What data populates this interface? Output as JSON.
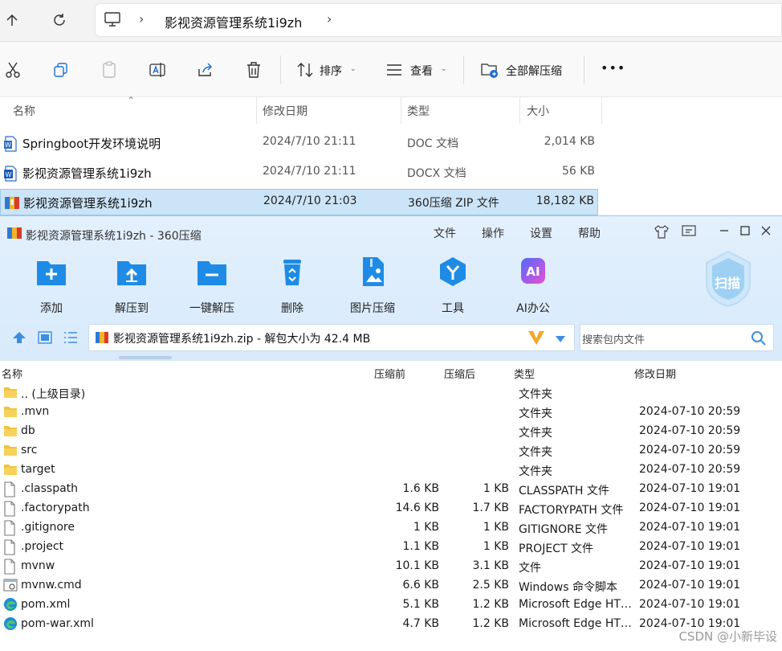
{
  "explorer": {
    "breadcrumb": "影视资源管理系统1i9zh",
    "toolbar": {
      "sort_label": "排序",
      "view_label": "查看",
      "extract_all_label": "全部解压缩",
      "more_label": "•••"
    },
    "columns": {
      "name": "名称",
      "date": "修改日期",
      "type": "类型",
      "size": "大小"
    },
    "files": [
      {
        "name": "Springboot开发环境说明",
        "date": "2024/7/10 21:11",
        "type": "DOC 文档",
        "size": "2,014 KB"
      },
      {
        "name": "影视资源管理系统1i9zh",
        "date": "2024/7/10 21:11",
        "type": "DOCX 文档",
        "size": "56 KB"
      },
      {
        "name": "影视资源管理系统1i9zh",
        "date": "2024/7/10 21:03",
        "type": "360压缩 ZIP 文件",
        "size": "18,182 KB"
      }
    ]
  },
  "zip": {
    "title": "影视资源管理系统1i9zh - 360压缩",
    "menu": [
      "文件",
      "操作",
      "设置",
      "帮助"
    ],
    "buttons": [
      "添加",
      "解压到",
      "一键解压",
      "删除",
      "图片压缩",
      "工具",
      "AI办公"
    ],
    "scan_label": "扫描",
    "path": "影视资源管理系统1i9zh.zip - 解包大小为 42.4 MB",
    "search_placeholder": "搜索包内文件",
    "columns": {
      "name": "名称",
      "before": "压缩前",
      "after": "压缩后",
      "type": "类型",
      "date": "修改日期"
    },
    "rows": [
      {
        "icon": "folder",
        "name": ".. (上级目录)",
        "before": "",
        "after": "",
        "type": "文件夹",
        "date": ""
      },
      {
        "icon": "folder",
        "name": ".mvn",
        "before": "",
        "after": "",
        "type": "文件夹",
        "date": "2024-07-10 20:59"
      },
      {
        "icon": "folder",
        "name": "db",
        "before": "",
        "after": "",
        "type": "文件夹",
        "date": "2024-07-10 20:59"
      },
      {
        "icon": "folder",
        "name": "src",
        "before": "",
        "after": "",
        "type": "文件夹",
        "date": "2024-07-10 20:59"
      },
      {
        "icon": "folder",
        "name": "target",
        "before": "",
        "after": "",
        "type": "文件夹",
        "date": "2024-07-10 20:59"
      },
      {
        "icon": "file",
        "name": ".classpath",
        "before": "1.6 KB",
        "after": "1 KB",
        "type": "CLASSPATH 文件",
        "date": "2024-07-10 19:01"
      },
      {
        "icon": "file",
        "name": ".factorypath",
        "before": "14.6 KB",
        "after": "1.7 KB",
        "type": "FACTORYPATH 文件",
        "date": "2024-07-10 19:01"
      },
      {
        "icon": "file",
        "name": ".gitignore",
        "before": "1 KB",
        "after": "1 KB",
        "type": "GITIGNORE 文件",
        "date": "2024-07-10 19:01"
      },
      {
        "icon": "file",
        "name": ".project",
        "before": "1.1 KB",
        "after": "1 KB",
        "type": "PROJECT 文件",
        "date": "2024-07-10 19:01"
      },
      {
        "icon": "file",
        "name": "mvnw",
        "before": "10.1 KB",
        "after": "3.1 KB",
        "type": "文件",
        "date": "2024-07-10 19:01"
      },
      {
        "icon": "cmd",
        "name": "mvnw.cmd",
        "before": "6.6 KB",
        "after": "2.5 KB",
        "type": "Windows 命令脚本",
        "date": "2024-07-10 19:01"
      },
      {
        "icon": "edge",
        "name": "pom.xml",
        "before": "5.1 KB",
        "after": "1.2 KB",
        "type": "Microsoft Edge HT…",
        "date": "2024-07-10 19:01"
      },
      {
        "icon": "edge",
        "name": "pom-war.xml",
        "before": "4.7 KB",
        "after": "1.2 KB",
        "type": "Microsoft Edge HT…",
        "date": "2024-07-10 19:01"
      }
    ]
  },
  "watermark": "CSDN @小新毕设"
}
